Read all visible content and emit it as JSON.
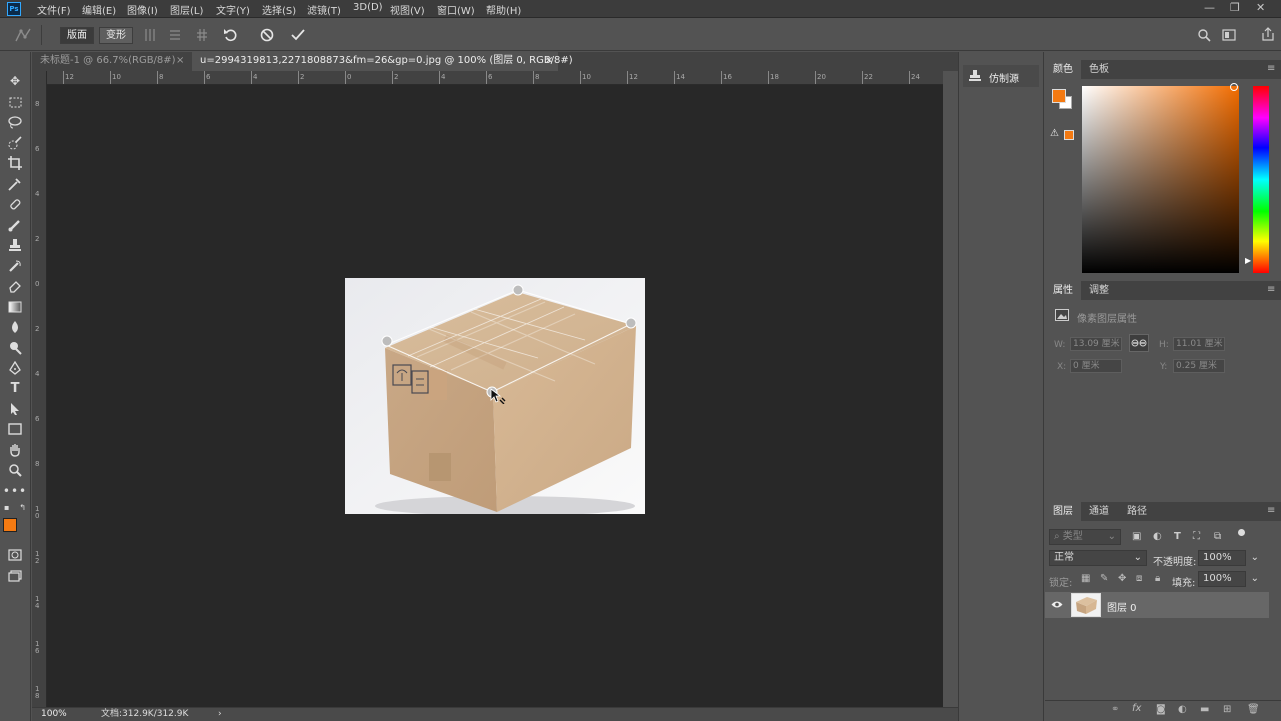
{
  "app": {
    "logo": "Ps"
  },
  "menubar": {
    "items": [
      "文件(F)",
      "编辑(E)",
      "图像(I)",
      "图层(L)",
      "文字(Y)",
      "选择(S)",
      "滤镜(T)",
      "3D(D)",
      "视图(V)",
      "窗口(W)",
      "帮助(H)"
    ],
    "window_controls": [
      "—",
      "❐",
      "✕"
    ]
  },
  "options": {
    "mode_layout": "版面",
    "mode_transform": "变形",
    "icons": [
      "puppet-warp-icon",
      "split-vertical-icon",
      "split-horizontal-icon",
      "grid-split-icon",
      "reset-icon",
      "cancel-icon",
      "commit-icon"
    ],
    "right_icons": [
      "search-icon",
      "workspace-icon",
      "share-icon"
    ]
  },
  "tabs": {
    "doc1": "未标题-1 @ 66.7%(RGB/8#)",
    "doc2": "u=2994319813,2271808873&fm=26&gp=0.jpg @ 100% (图层 0, RGB/8#)",
    "close": "×"
  },
  "rulers": {
    "h": [
      "12",
      "10",
      "8",
      "6",
      "4",
      "2",
      "0",
      "2",
      "4",
      "6",
      "8",
      "10",
      "12",
      "14",
      "16",
      "18",
      "20",
      "22",
      "24"
    ],
    "v": [
      "8",
      "6",
      "4",
      "2",
      "0",
      "2",
      "4",
      "6",
      "8",
      "1 0",
      "1 2",
      "1 4",
      "1 6",
      "1 8"
    ]
  },
  "status": {
    "zoom": "100%",
    "doc": "文档:312.9K/312.9K",
    "arrow": "›"
  },
  "clone_source": {
    "label": "仿制源"
  },
  "color_panel": {
    "tabs": [
      "颜色",
      "色板"
    ],
    "foreground": "#f47a12",
    "background": "#ffffff",
    "warning": "⚠"
  },
  "properties": {
    "tabs": [
      "属性",
      "调整"
    ],
    "title": "像素图层属性",
    "w_label": "W:",
    "w_value": "13.09 厘米",
    "h_label": "H:",
    "h_value": "11.01 厘米",
    "x_label": "X:",
    "x_value": "0 厘米",
    "y_label": "Y:",
    "y_value": "0.25 厘米"
  },
  "layers": {
    "tabs": [
      "图层",
      "通道",
      "路径"
    ],
    "filter_placeholder": "类型",
    "blend_mode": "正常",
    "opacity_label": "不透明度:",
    "opacity_value": "100%",
    "lock_label": "锁定:",
    "fill_label": "填充:",
    "fill_value": "100%",
    "items": [
      {
        "name": "图层 0",
        "visible": true
      }
    ]
  },
  "colors": {
    "accent": "#f47a12",
    "panel": "#535353",
    "canvas": "#282828",
    "dark": "#424242"
  }
}
